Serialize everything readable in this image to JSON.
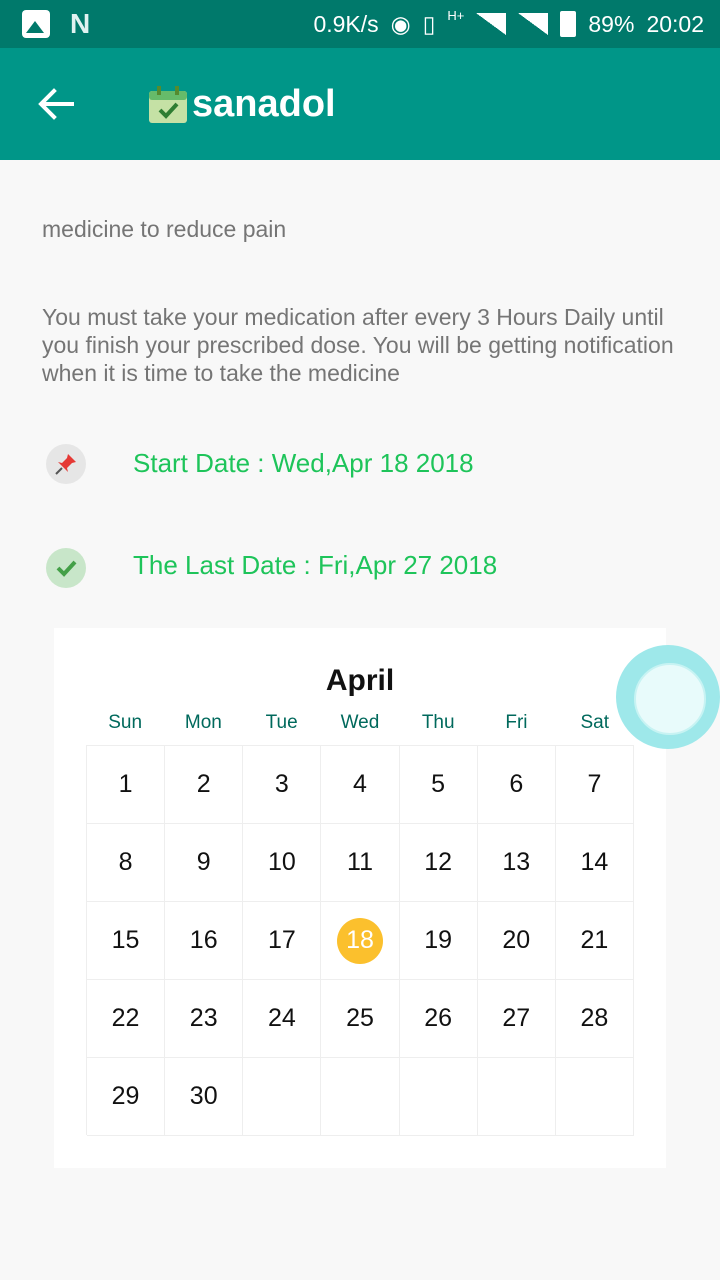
{
  "status_bar": {
    "speed": "0.9K/s",
    "network": "H+",
    "battery": "89%",
    "time": "20:02"
  },
  "app_bar": {
    "title": "sanadol",
    "back_icon": "arrow-left-icon",
    "app_icon": "calendar-check-icon",
    "color": "#009688"
  },
  "content": {
    "description": "medicine to reduce pain",
    "instructions": "You must take your medication after every 3 Hours Daily until you finish your prescribed dose. You will be getting notification when it is time to take the medicine",
    "start_date": "Start Date : Wed,Apr 18 2018",
    "last_date": "The Last Date : Fri,Apr 27 2018",
    "accent_green": "#1ec45a"
  },
  "calendar": {
    "month": "April",
    "weekdays": [
      "Sun",
      "Mon",
      "Tue",
      "Wed",
      "Thu",
      "Fri",
      "Sat"
    ],
    "weeks": [
      [
        "1",
        "2",
        "3",
        "4",
        "5",
        "6",
        "7"
      ],
      [
        "8",
        "9",
        "10",
        "11",
        "12",
        "13",
        "14"
      ],
      [
        "15",
        "16",
        "17",
        "18",
        "19",
        "20",
        "21"
      ],
      [
        "22",
        "23",
        "24",
        "25",
        "26",
        "27",
        "28"
      ],
      [
        "29",
        "30",
        "",
        "",
        "",
        "",
        ""
      ]
    ],
    "selected_day": "18",
    "highlight_color": "#fbc02d"
  }
}
